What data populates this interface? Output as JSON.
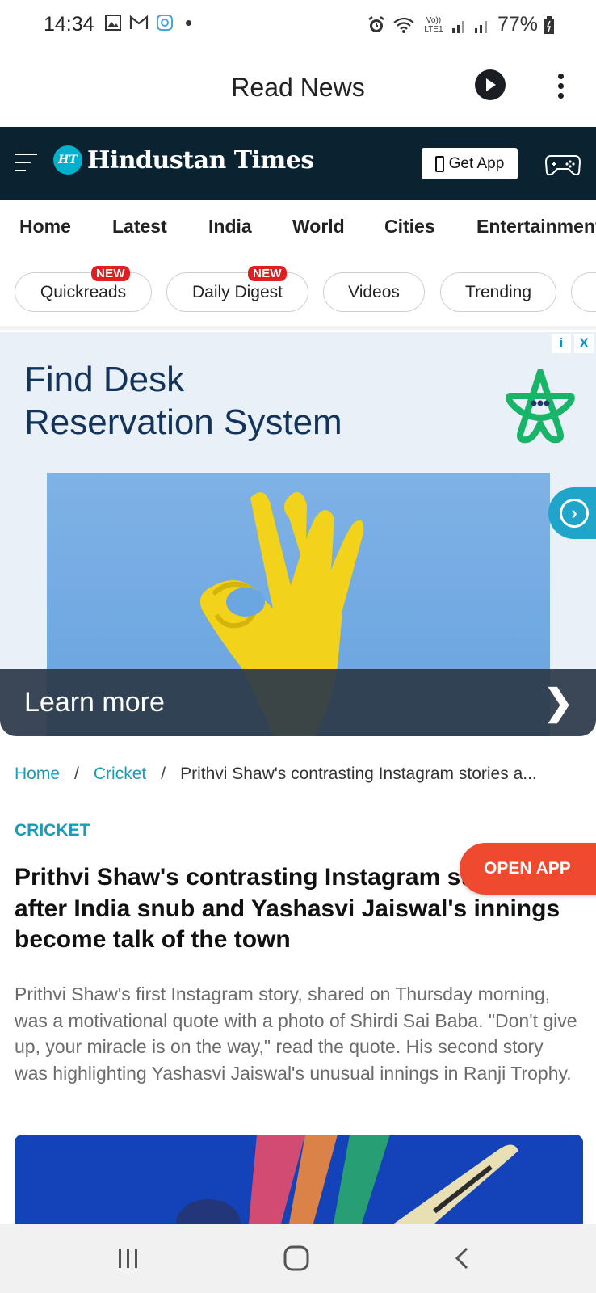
{
  "status_bar": {
    "time": "14:34",
    "left_icons": [
      "gallery-icon",
      "gmail-icon",
      "app-icon",
      "dot-icon"
    ],
    "right_icons": [
      "alarm-icon",
      "wifi-icon",
      "volte-icon",
      "signal-icon"
    ],
    "network_label": "Vo)) LTE1",
    "battery": "77%"
  },
  "app_bar": {
    "title": "Read News",
    "play_icon": "play-icon",
    "more_icon": "more-vertical-icon"
  },
  "site_header": {
    "logo_badge": "HT",
    "logo_name": "Hindustan Times",
    "get_app_label": "Get App",
    "brand_color": "#0b2230",
    "accent_color": "#00b1cd"
  },
  "nav_tabs": [
    "Home",
    "Latest",
    "India",
    "World",
    "Cities",
    "Entertainment"
  ],
  "chips": [
    {
      "label": "Quickreads",
      "badge": "NEW"
    },
    {
      "label": "Daily Digest",
      "badge": "NEW"
    },
    {
      "label": "Videos",
      "badge": ""
    },
    {
      "label": "Trending",
      "badge": ""
    }
  ],
  "ad": {
    "adchoices": [
      "i",
      "X"
    ],
    "title_line1": "Find Desk",
    "title_line2": "Reservation System",
    "cta": "Learn more"
  },
  "breadcrumb": {
    "home": "Home",
    "section": "Cricket",
    "current": "Prithvi Shaw's contrasting Instagram stories a..."
  },
  "article": {
    "section": "CRICKET",
    "headline": "Prithvi Shaw's contrasting Instagram stories after India snub and Yashasvi Jaiswal's innings become talk of the town",
    "summary": "Prithvi Shaw's first Instagram story, shared on Thursday morning, was a motivational quote with a photo of Shirdi Sai Baba. \"Don't give up, your miracle is on the way,\" read the quote. His second story was highlighting Yashasvi Jaiswal's unusual innings in Ranji Trophy."
  },
  "open_app_label": "OPEN APP",
  "system_nav": [
    "recents-icon",
    "home-icon",
    "back-icon"
  ]
}
